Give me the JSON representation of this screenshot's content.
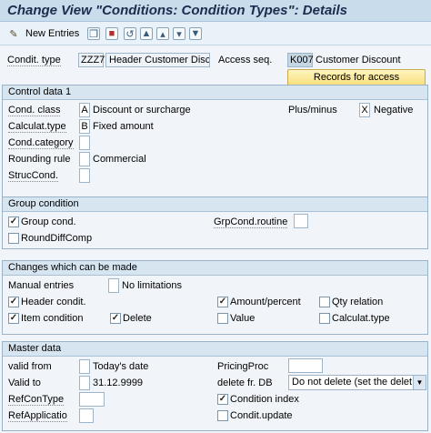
{
  "window": {
    "title": "Change View \"Conditions: Condition Types\": Details"
  },
  "toolbar": {
    "new_entries_label": "New Entries",
    "icons": [
      "edit-pencil-icon",
      "copy-icon",
      "save-as-icon",
      "undo-icon",
      "first-page-icon",
      "prev-page-icon",
      "next-page-icon",
      "last-page-icon"
    ]
  },
  "header": {
    "condit_type_label": "Condit. type",
    "condit_type_value": "ZZZ7",
    "condit_type_desc": "Header Customer Disc",
    "access_seq_label": "Access seq.",
    "access_seq_value": "K007",
    "access_seq_desc": "Customer Discount",
    "records_button": "Records for access"
  },
  "control_data": {
    "title": "Control data 1",
    "cond_class_label": "Cond. class",
    "cond_class_value": "A",
    "cond_class_desc": "Discount or surcharge",
    "plus_minus_label": "Plus/minus",
    "plus_minus_value": "X",
    "plus_minus_desc": "Negative",
    "calculat_type_label": "Calculat.type",
    "calculat_type_value": "B",
    "calculat_type_desc": "Fixed amount",
    "cond_category_label": "Cond.category",
    "rounding_rule_label": "Rounding rule",
    "rounding_rule_desc": "Commercial",
    "struc_cond_label": "StrucCond."
  },
  "group_condition": {
    "title": "Group condition",
    "group_cond_label": "Group cond.",
    "group_cond_checked": true,
    "grp_cond_routine_label": "GrpCond.routine",
    "round_diff_comp_label": "RoundDiffComp",
    "round_diff_comp_checked": false
  },
  "changes": {
    "title": "Changes which can be made",
    "manual_entries_label": "Manual entries",
    "manual_entries_desc": "No limitations",
    "header_condit_label": "Header condit.",
    "header_condit_checked": true,
    "amount_percent_label": "Amount/percent",
    "amount_percent_checked": true,
    "qty_relation_label": "Qty relation",
    "qty_relation_checked": false,
    "item_condition_label": "Item condition",
    "item_condition_checked": true,
    "delete_label": "Delete",
    "delete_checked": true,
    "value_label": "Value",
    "value_checked": false,
    "calculat_type_label": "Calculat.type",
    "calculat_type_checked": false
  },
  "master_data": {
    "title": "Master data",
    "valid_from_label": "valid from",
    "valid_from_desc": "Today's date",
    "pricing_proc_label": "PricingProc",
    "valid_to_label": "Valid to",
    "valid_to_value": "31.12.9999",
    "delete_fr_db_label": "delete fr. DB",
    "delete_fr_db_value": "Do not delete (set the delet...",
    "ref_con_type_label": "RefConType",
    "condition_index_label": "Condition index",
    "condition_index_checked": true,
    "ref_applicatio_label": "RefApplicatio",
    "condit_update_label": "Condit.update",
    "condit_update_checked": false
  }
}
